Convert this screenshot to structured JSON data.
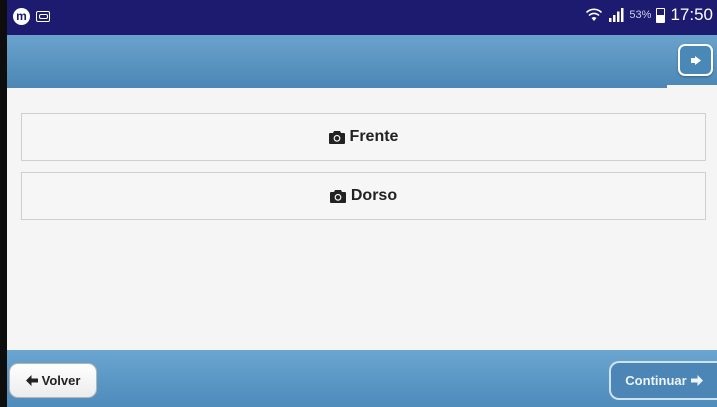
{
  "status_bar": {
    "app_icon_letter": "m",
    "battery_percent": "53%",
    "time": "17:50",
    "icons": [
      "app-notification-icon",
      "voicemail-icon",
      "wifi-icon",
      "signal-icon",
      "battery-icon"
    ]
  },
  "header": {
    "logout_icon": "logout-icon"
  },
  "options": {
    "front": {
      "label": "Frente",
      "icon": "camera-icon"
    },
    "back": {
      "label": "Dorso",
      "icon": "camera-icon"
    }
  },
  "footer": {
    "back_label": "Volver",
    "back_icon": "arrow-left-icon",
    "continue_label": "Continuar",
    "continue_icon": "arrow-right-icon"
  },
  "colors": {
    "status_bar": "#1d1b70",
    "header": "#5a95c2",
    "footer": "#5d99c6",
    "content_bg": "#f5f5f6"
  }
}
